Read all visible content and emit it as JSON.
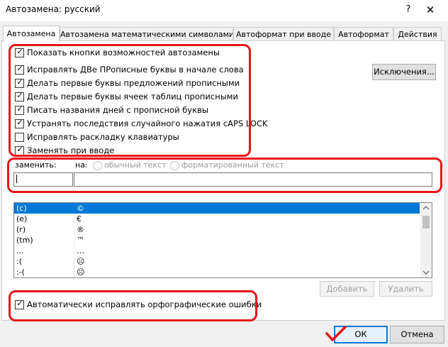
{
  "window": {
    "title": "Автозамена: русский",
    "help_label": "?",
    "close_label": "✕"
  },
  "tabs": [
    {
      "label": "Автозамена"
    },
    {
      "label": "Автозамена математическими символами"
    },
    {
      "label": "Автоформат при вводе"
    },
    {
      "label": "Автоформат"
    },
    {
      "label": "Действия"
    }
  ],
  "checkboxes": [
    {
      "label": "Показать кнопки возможностей автозамены",
      "checked": true
    },
    {
      "label": "Исправлять ДВе ПРописные буквы в начале слова",
      "checked": true
    },
    {
      "label": "Делать первые буквы предложений прописными",
      "checked": true
    },
    {
      "label": "Делать первые буквы ячеек таблиц прописными",
      "checked": true
    },
    {
      "label": "Писать названия дней с прописной буквы",
      "checked": true
    },
    {
      "label": "Устранять последствия случайного нажатия cAPS LOCK",
      "checked": true
    },
    {
      "label": "Исправлять раскладку клавиатуры",
      "checked": false
    },
    {
      "label": "Заменять при вводе",
      "checked": true
    }
  ],
  "exceptions_button": "Исключения...",
  "replace": {
    "replace_label": "заменить:",
    "with_label": "на:",
    "plain_text": "обычный текст",
    "formatted_text": "форматированный текст",
    "replace_value": "",
    "with_value": ""
  },
  "list": [
    {
      "from": "(c)",
      "to": "©"
    },
    {
      "from": "(e)",
      "to": "€"
    },
    {
      "from": "(r)",
      "to": "®"
    },
    {
      "from": "(tm)",
      "to": "™"
    },
    {
      "from": "...",
      "to": "…"
    },
    {
      "from": ":(",
      "to": "☹"
    },
    {
      "from": ":-(",
      "to": "☹"
    }
  ],
  "add_button": "Добавить",
  "delete_button": "Удалить",
  "autocorrect_spelling": {
    "label": "Автоматически исправлять орфографические ошибки",
    "checked": true
  },
  "ok_button": "ОК",
  "cancel_button": "Отмена",
  "check_mark": "✓",
  "colors": {
    "highlight": "#e8141b",
    "selection": "#0078d7"
  }
}
